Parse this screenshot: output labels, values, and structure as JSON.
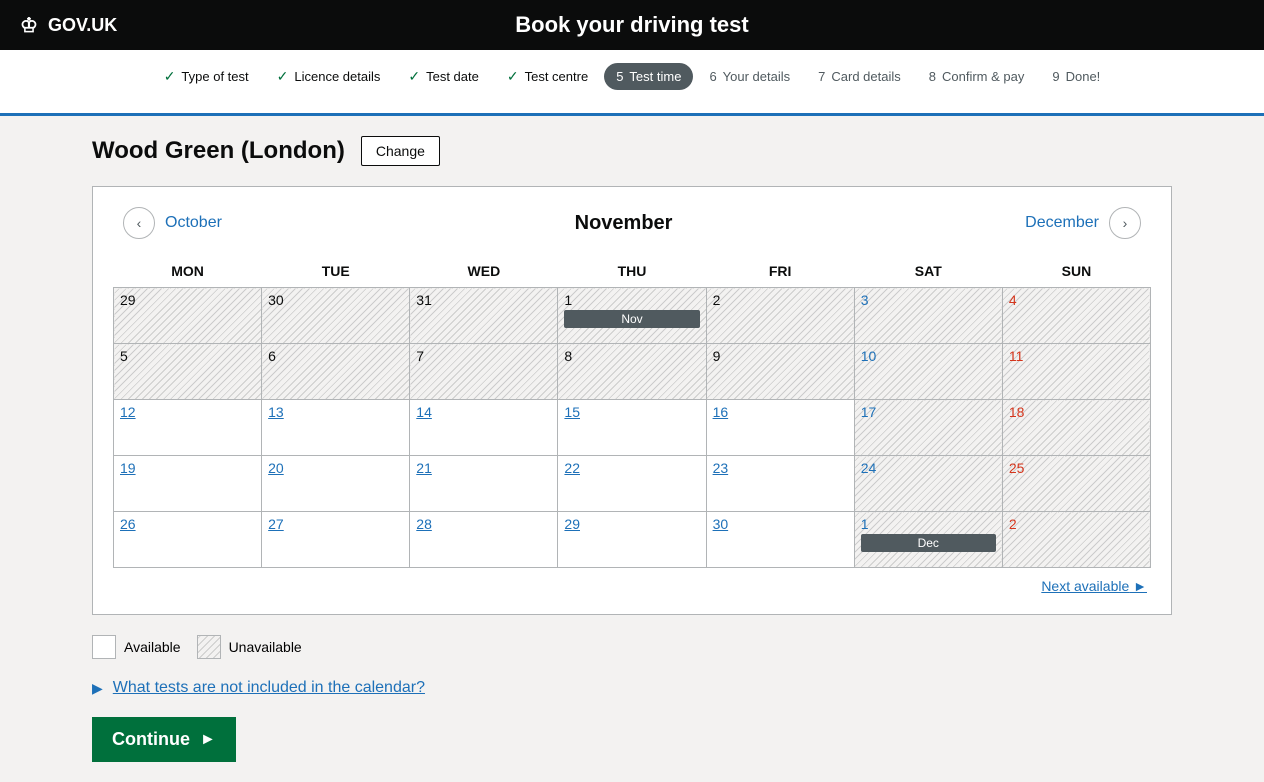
{
  "header": {
    "logo_text": "GOV.UK",
    "title": "Book your driving test"
  },
  "progress": {
    "steps": [
      {
        "id": "type-of-test",
        "num": "",
        "label": "Type of test",
        "status": "completed"
      },
      {
        "id": "licence-details",
        "num": "",
        "label": "Licence details",
        "status": "completed"
      },
      {
        "id": "test-date",
        "num": "",
        "label": "Test date",
        "status": "completed"
      },
      {
        "id": "test-centre",
        "num": "",
        "label": "Test centre",
        "status": "completed"
      },
      {
        "id": "test-time",
        "num": "5",
        "label": "Test time",
        "status": "active"
      },
      {
        "id": "your-details",
        "num": "6",
        "label": "Your details",
        "status": "inactive"
      },
      {
        "id": "card-details",
        "num": "7",
        "label": "Card details",
        "status": "inactive"
      },
      {
        "id": "confirm-pay",
        "num": "8",
        "label": "Confirm & pay",
        "status": "inactive"
      },
      {
        "id": "done",
        "num": "9",
        "label": "Done!",
        "status": "inactive"
      }
    ]
  },
  "location": {
    "name": "Wood Green (London)",
    "change_label": "Change"
  },
  "calendar": {
    "prev_month": "October",
    "current_month": "November",
    "next_month": "December",
    "days_of_week": [
      "MON",
      "TUE",
      "WED",
      "THU",
      "FRI",
      "SAT",
      "SUN"
    ],
    "weeks": [
      [
        {
          "num": "29",
          "available": false,
          "prev_month": true
        },
        {
          "num": "30",
          "available": false,
          "prev_month": true
        },
        {
          "num": "31",
          "available": false,
          "prev_month": true
        },
        {
          "num": "1",
          "available": false,
          "badge": "Nov"
        },
        {
          "num": "2",
          "available": false
        },
        {
          "num": "3",
          "available": false,
          "is_sat": true
        },
        {
          "num": "4",
          "available": false,
          "is_sun": true
        }
      ],
      [
        {
          "num": "5",
          "available": false
        },
        {
          "num": "6",
          "available": false
        },
        {
          "num": "7",
          "available": false
        },
        {
          "num": "8",
          "available": false
        },
        {
          "num": "9",
          "available": false
        },
        {
          "num": "10",
          "available": false,
          "is_sat": true
        },
        {
          "num": "11",
          "available": false,
          "is_sun": true
        }
      ],
      [
        {
          "num": "12",
          "available": true
        },
        {
          "num": "13",
          "available": true
        },
        {
          "num": "14",
          "available": true
        },
        {
          "num": "15",
          "available": true
        },
        {
          "num": "16",
          "available": true,
          "is_fri_blue": true
        },
        {
          "num": "17",
          "available": false,
          "is_sat": true
        },
        {
          "num": "18",
          "available": false,
          "is_sun": true
        }
      ],
      [
        {
          "num": "19",
          "available": true
        },
        {
          "num": "20",
          "available": true
        },
        {
          "num": "21",
          "available": true
        },
        {
          "num": "22",
          "available": true
        },
        {
          "num": "23",
          "available": true
        },
        {
          "num": "24",
          "available": false,
          "is_sat": true
        },
        {
          "num": "25",
          "available": false,
          "is_sun": true
        }
      ],
      [
        {
          "num": "26",
          "available": true
        },
        {
          "num": "27",
          "available": true
        },
        {
          "num": "28",
          "available": true
        },
        {
          "num": "29",
          "available": true
        },
        {
          "num": "30",
          "available": true
        },
        {
          "num": "1",
          "available": false,
          "is_sat": true,
          "badge": "Dec"
        },
        {
          "num": "2",
          "available": false,
          "is_sun": true
        }
      ]
    ],
    "next_available_label": "Next available"
  },
  "legend": {
    "available_label": "Available",
    "unavailable_label": "Unavailable"
  },
  "info_link": {
    "text": "What tests are not included in the calendar?"
  },
  "continue_btn": {
    "label": "Continue"
  }
}
